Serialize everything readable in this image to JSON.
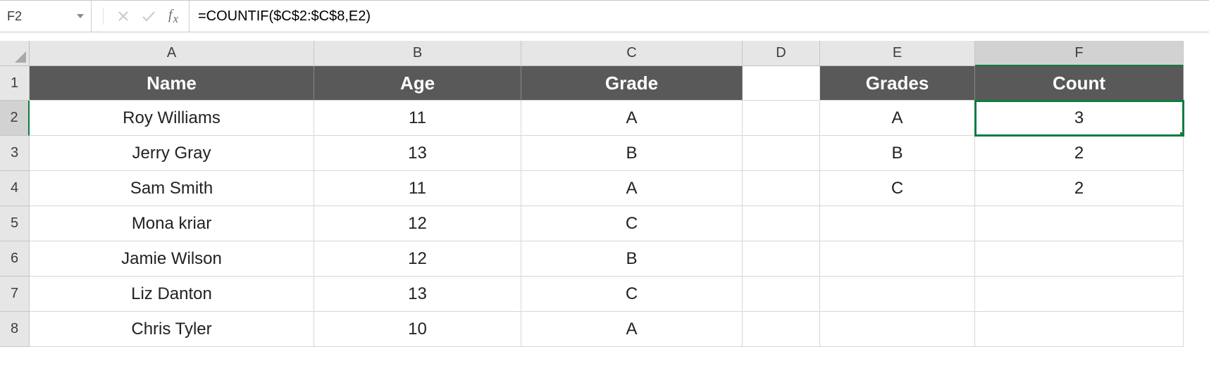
{
  "formula_bar": {
    "name_box": "F2",
    "formula": "=COUNTIF($C$2:$C$8,E2)"
  },
  "columns": {
    "A": "A",
    "B": "B",
    "C": "C",
    "D": "D",
    "E": "E",
    "F": "F"
  },
  "row_numbers": [
    "1",
    "2",
    "3",
    "4",
    "5",
    "6",
    "7",
    "8"
  ],
  "selected_cell": "F2",
  "headers": {
    "A": "Name",
    "B": "Age",
    "C": "Grade",
    "E": "Grades",
    "F": "Count"
  },
  "rows": [
    {
      "name": "Roy Williams",
      "age": "11",
      "grade": "A",
      "grades": "A",
      "count": "3"
    },
    {
      "name": "Jerry Gray",
      "age": "13",
      "grade": "B",
      "grades": "B",
      "count": "2"
    },
    {
      "name": "Sam Smith",
      "age": "11",
      "grade": "A",
      "grades": "C",
      "count": "2"
    },
    {
      "name": "Mona kriar",
      "age": "12",
      "grade": "C",
      "grades": "",
      "count": ""
    },
    {
      "name": "Jamie Wilson",
      "age": "12",
      "grade": "B",
      "grades": "",
      "count": ""
    },
    {
      "name": "Liz Danton",
      "age": "13",
      "grade": "C",
      "grades": "",
      "count": ""
    },
    {
      "name": "Chris Tyler",
      "age": "10",
      "grade": "A",
      "grades": "",
      "count": ""
    }
  ]
}
